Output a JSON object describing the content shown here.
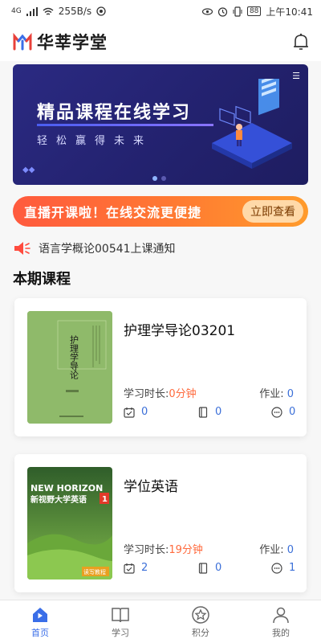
{
  "status": {
    "network_speed": "255B/s",
    "battery": "88",
    "time": "上午10:41",
    "signal": "4G"
  },
  "header": {
    "title": "华莘学堂"
  },
  "banner": {
    "title": "精品课程在线学习",
    "subtitle": "轻松赢得未来"
  },
  "promo": {
    "text": "直播开课啦！在线交流更便捷",
    "button": "立即查看"
  },
  "notice": {
    "text": "语言学概论00541上课通知"
  },
  "section": {
    "title": "本期课程"
  },
  "courses": [
    {
      "name": "护理学导论03201",
      "duration_label": "学习时长:",
      "duration_value": "0分钟",
      "homework_label": "作业:",
      "homework_value": "0",
      "stats": [
        "0",
        "0",
        "0"
      ],
      "cover_title": "护理学导论",
      "cover_color": "#8fba6a"
    },
    {
      "name": "学位英语",
      "duration_label": "学习时长:",
      "duration_value": "19分钟",
      "homework_label": "作业:",
      "homework_value": "0",
      "stats": [
        "2",
        "0",
        "1"
      ],
      "cover_brand": "NEW HORIZON",
      "cover_title": "新视野大学英语",
      "cover_badge": "1",
      "cover_tag": "读写教程",
      "cover_color": "#5e9a3a"
    }
  ],
  "tabbar": [
    {
      "label": "首页",
      "icon": "home-icon",
      "active": true
    },
    {
      "label": "学习",
      "icon": "book-icon",
      "active": false
    },
    {
      "label": "积分",
      "icon": "star-icon",
      "active": false
    },
    {
      "label": "我的",
      "icon": "user-icon",
      "active": false
    }
  ],
  "colors": {
    "accent": "#3a6ee8",
    "orange": "#ff6a3d",
    "banner": "#2b2a82"
  }
}
